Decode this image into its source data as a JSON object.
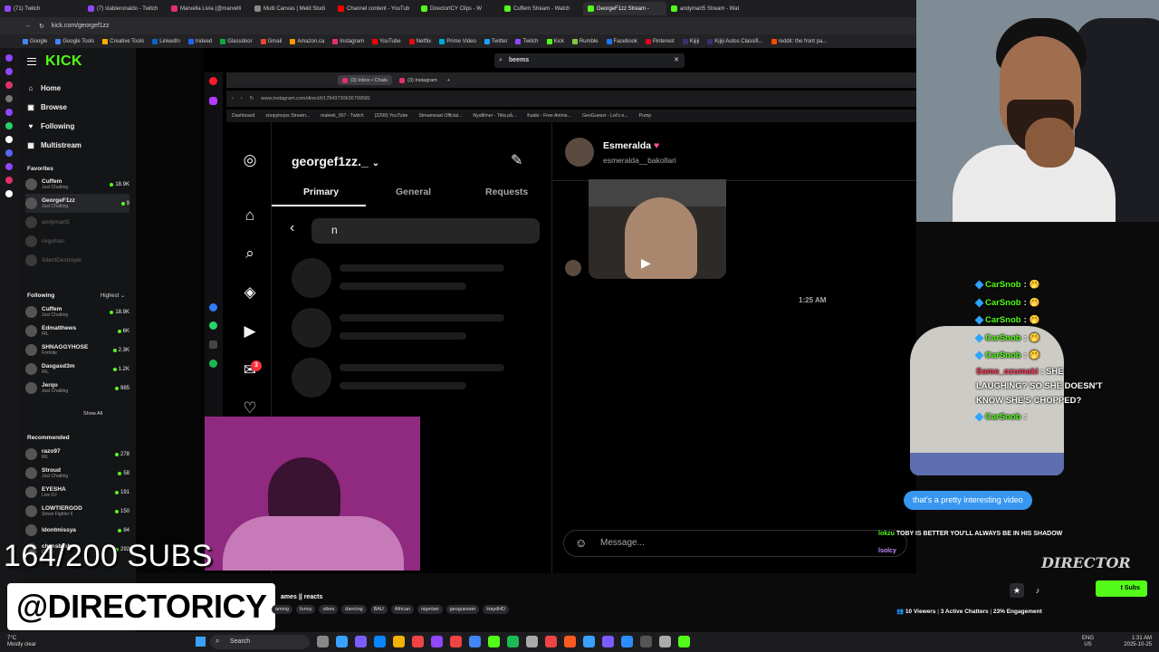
{
  "browser": {
    "tabs": [
      {
        "label": "(71) Twitch",
        "color": "#9146ff"
      },
      {
        "label": "(7) stableronaldo - Twitch",
        "color": "#9146ff"
      },
      {
        "label": "Marvella Livia (@marvelli",
        "color": "#e1306c"
      },
      {
        "label": "Multi Canvas | Meld Studi",
        "color": "#888888"
      },
      {
        "label": "Channel content - YouTub",
        "color": "#ff0000"
      },
      {
        "label": "DirectorICY Clips - W",
        "color": "#53fc18"
      },
      {
        "label": "Cuffem Stream - Watch",
        "color": "#53fc18"
      },
      {
        "label": "GeorgeF1zz Stream -",
        "color": "#53fc18"
      },
      {
        "label": "andymart5 Stream - Wat",
        "color": "#53fc18"
      }
    ],
    "url": "kick.com/georgef1zz",
    "bookmarks": [
      "Google",
      "Google Tools",
      "Creative Tools",
      "LinkedIn",
      "Indeed",
      "Glassdoor",
      "Gmail",
      "Amazon.ca",
      "Instagram",
      "YouTube",
      "Netflix",
      "Prime Video",
      "Twitter",
      "Twitch",
      "Kick",
      "Rumble",
      "Facebook",
      "Pinterest",
      "Kijiji",
      "Kijiji Autos Classifi...",
      "reddit: the front pa..."
    ]
  },
  "kick": {
    "logo": "KICK",
    "nav": [
      {
        "label": "Home",
        "icon": "home-icon",
        "glyph": "⌂"
      },
      {
        "label": "Browse",
        "icon": "browse-icon",
        "glyph": "▣"
      },
      {
        "label": "Following",
        "icon": "heart-icon",
        "glyph": "♥"
      },
      {
        "label": "Multistream",
        "icon": "multistream-icon",
        "glyph": "▦"
      }
    ],
    "favorites_title": "Favorites",
    "favorites": [
      {
        "name": "Cuffem",
        "sub": "Just Chatting",
        "viewers": "18.9K",
        "live": true
      },
      {
        "name": "GeorgeF1zz",
        "sub": "Just Chatting",
        "viewers": "9",
        "live": true
      },
      {
        "name": "andymart5",
        "sub": "",
        "viewers": "",
        "live": false
      },
      {
        "name": "ceguhan",
        "sub": "",
        "viewers": "",
        "live": false
      },
      {
        "name": "SilentDestroyer",
        "sub": "",
        "viewers": "",
        "live": false
      }
    ],
    "following_title": "Following",
    "following_sort": "Highest",
    "following": [
      {
        "name": "Cuffem",
        "sub": "Just Chatting",
        "viewers": "18.9K"
      },
      {
        "name": "Edmatthews",
        "sub": "IRL",
        "viewers": "6K"
      },
      {
        "name": "SHNAGGYHOSE",
        "sub": "Fortnite",
        "viewers": "2.3K"
      },
      {
        "name": "Dasgasd3m",
        "sub": "IRL",
        "viewers": "1.2K"
      },
      {
        "name": "Jerqo",
        "sub": "Just Chatting",
        "viewers": "985"
      }
    ],
    "show_all": "Show All",
    "recommended_title": "Recommended",
    "recommended": [
      {
        "name": "razo97",
        "sub": "IRL",
        "viewers": "278"
      },
      {
        "name": "Stroud",
        "sub": "Just Chatting",
        "viewers": "58"
      },
      {
        "name": "EYESHA",
        "sub": "Live DJ",
        "viewers": "191"
      },
      {
        "name": "LOWTIERGOD",
        "sub": "Street Fighter 6",
        "viewers": "150"
      },
      {
        "name": "ldontmissya",
        "sub": "",
        "viewers": "84"
      },
      {
        "name": "chessbrah",
        "sub": "Chess",
        "viewers": "292"
      }
    ],
    "search_value": "beems"
  },
  "nested_browser": {
    "tabs": [
      "(3) Inbox • Chats",
      "(3) Instagram"
    ],
    "url": "www.instagram.com/direct/t/17843730636799581",
    "bookmarks": [
      "Dashboard",
      "zoopyloops Stream...",
      "maleek_007 - Twitch",
      "(2299) YouTube",
      "Streameast Official...",
      "Nyafilmer - Titta på...",
      "Kaido - Free Anime...",
      "GeoGuessr - Let's e...",
      "Pump"
    ]
  },
  "instagram": {
    "username": "georgef1zz._",
    "tabs": [
      "Primary",
      "General",
      "Requests"
    ],
    "search_value": "n",
    "notification_count": "3",
    "chat": {
      "name": "Esmeralda",
      "handle": "esmeralda__bakollari",
      "timestamp": "1:25 AM",
      "outgoing": "that's a pretty interesting video",
      "placeholder": "Message..."
    }
  },
  "stream_chat": [
    {
      "user": "CarSnob",
      "text": ":"
    },
    {
      "user": "CarSnob",
      "text": ":"
    },
    {
      "user": "CarSnob",
      "text": ":"
    },
    {
      "user": "CarSnob",
      "text": ":"
    },
    {
      "user": "CarSnob",
      "text": ":"
    }
  ],
  "stream_chat_msg": {
    "user": "Same_ozumaki",
    "text": ": SHE LAUGHING? SO SHE DOESN'T KNOW SHE'S CHOPPED?"
  },
  "stream_chat_last": {
    "user": "CarSnob",
    "text": ":"
  },
  "bottom_chat": {
    "user": "lokzu",
    "text": "TOBY IS BETTER YOU'LL ALWAYS BE IN HIS SHADOW",
    "user2": "lsolcy"
  },
  "overlay": {
    "subs": "164/200 SUBS",
    "handle": "@DIRECTORICY",
    "director": "DIRECTOR"
  },
  "stream_info": {
    "title_fragment": "ames || reacts",
    "tags": [
      "aming",
      "funny",
      "vibes",
      "dancing",
      "BAU",
      "African",
      "nigerian",
      "geoguesser",
      "HaydHD"
    ],
    "viewers": "10 Viewers",
    "chatters": "3 Active Chatters",
    "engagement": "23% Engagement",
    "sub_button": "t Subs"
  },
  "taskbar": {
    "weather_temp": "7°C",
    "weather_text": "Mostly clear",
    "search": "Search",
    "lang1": "ENG",
    "lang2": "US",
    "time": "1:31 AM",
    "date": "2025-10-25"
  },
  "colors": {
    "kick_green": "#53fc18",
    "ig_blue": "#3797f0",
    "badge_red": "#ff3040"
  }
}
